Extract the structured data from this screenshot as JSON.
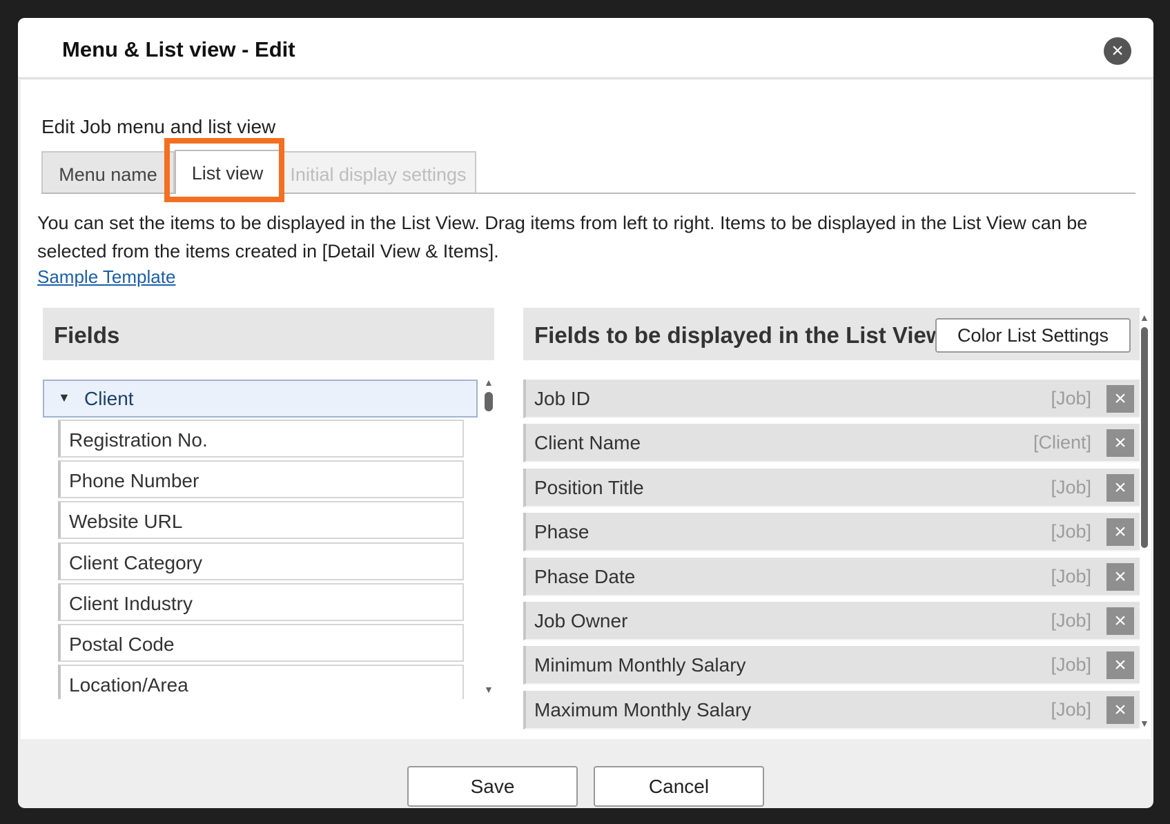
{
  "dialog": {
    "title": "Menu & List view - Edit",
    "close_icon": "×"
  },
  "subtitle": "Edit Job menu and list view",
  "tabs": [
    {
      "label": "Menu name",
      "state": "normal"
    },
    {
      "label": "List view",
      "state": "active"
    },
    {
      "label": "Initial display settings",
      "state": "disabled"
    }
  ],
  "description": "You can set the items to be displayed in the List View. Drag items from left to right. Items to be displayed in the List View can be selected from the items created in [Detail View & Items].",
  "sample_link": "Sample Template",
  "fields_panel": {
    "title": "Fields",
    "group": {
      "label": "Client",
      "expanded": true,
      "caret_icon": "▼"
    },
    "items": [
      {
        "label": "Registration No."
      },
      {
        "label": "Phone Number"
      },
      {
        "label": "Website URL"
      },
      {
        "label": "Client Category"
      },
      {
        "label": "Client Industry"
      },
      {
        "label": "Postal Code"
      },
      {
        "label": "Location/Area"
      }
    ]
  },
  "list_panel": {
    "title": "Fields to be displayed in the List View",
    "color_button": "Color List Settings",
    "remove_icon": "×",
    "items": [
      {
        "label": "Job ID",
        "source": "[Job]"
      },
      {
        "label": "Client Name",
        "source": "[Client]"
      },
      {
        "label": "Position Title",
        "source": "[Job]"
      },
      {
        "label": "Phase",
        "source": "[Job]"
      },
      {
        "label": "Phase Date",
        "source": "[Job]"
      },
      {
        "label": "Job Owner",
        "source": "[Job]"
      },
      {
        "label": "Minimum Monthly Salary",
        "source": "[Job]"
      },
      {
        "label": "Maximum Monthly Salary",
        "source": "[Job]"
      }
    ]
  },
  "footer": {
    "save_label": "Save",
    "cancel_label": "Cancel"
  },
  "colors": {
    "highlight": "#f36f21",
    "link": "#1a5fa8"
  }
}
